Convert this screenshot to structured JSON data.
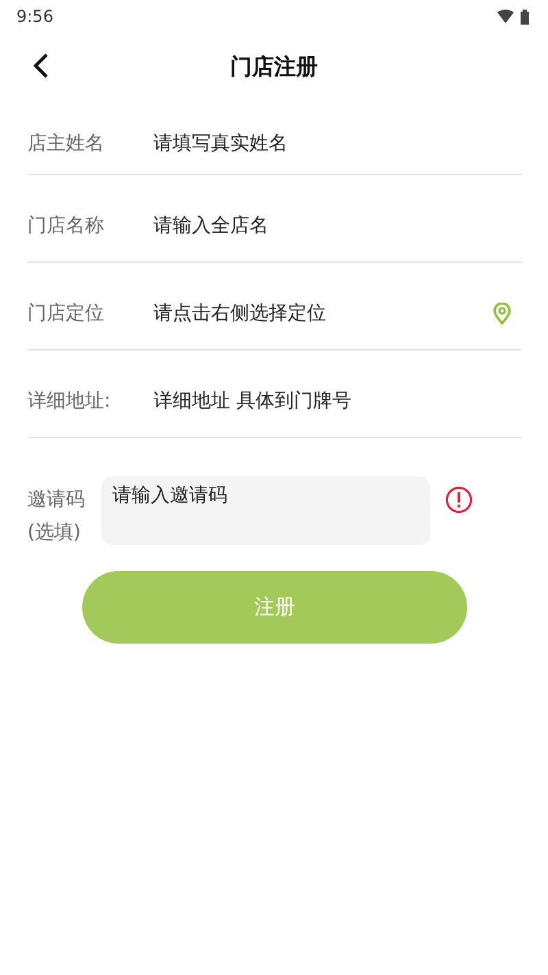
{
  "status_bar": {
    "time": "9:56"
  },
  "header": {
    "title": "门店注册"
  },
  "fields": [
    {
      "kind": "text",
      "label": "店主姓名",
      "placeholder": "请填写真实姓名"
    },
    {
      "kind": "text",
      "label": "门店名称",
      "placeholder": "请输入全店名"
    },
    {
      "kind": "location",
      "label": "门店定位",
      "placeholder": "请点击右侧选择定位"
    },
    {
      "kind": "text",
      "label": "详细地址:",
      "placeholder": "详细地址 具体到门牌号"
    }
  ],
  "invite": {
    "label": "邀请码",
    "sublabel": "(选填)",
    "placeholder": "请输入邀请码"
  },
  "submit": {
    "label": "注册"
  }
}
